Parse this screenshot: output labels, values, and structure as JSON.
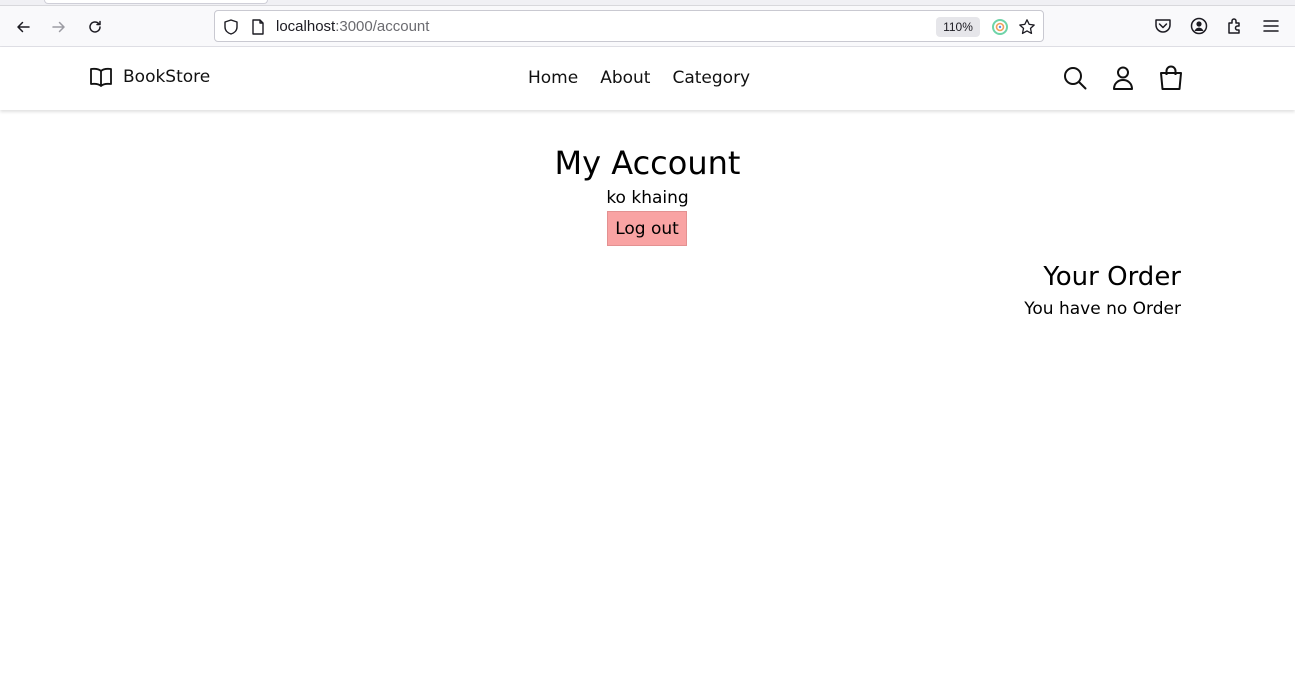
{
  "browser": {
    "url_host": "localhost",
    "url_path": ":3000/account",
    "zoom": "110%"
  },
  "header": {
    "brand": "BookStore",
    "nav": [
      "Home",
      "About",
      "Category"
    ]
  },
  "account": {
    "title": "My Account",
    "username": "ko khaing",
    "logout_label": "Log out"
  },
  "orders": {
    "title": "Your Order",
    "empty_message": "You have no Order"
  },
  "colors": {
    "logout_bg": "#f9a3a3"
  }
}
